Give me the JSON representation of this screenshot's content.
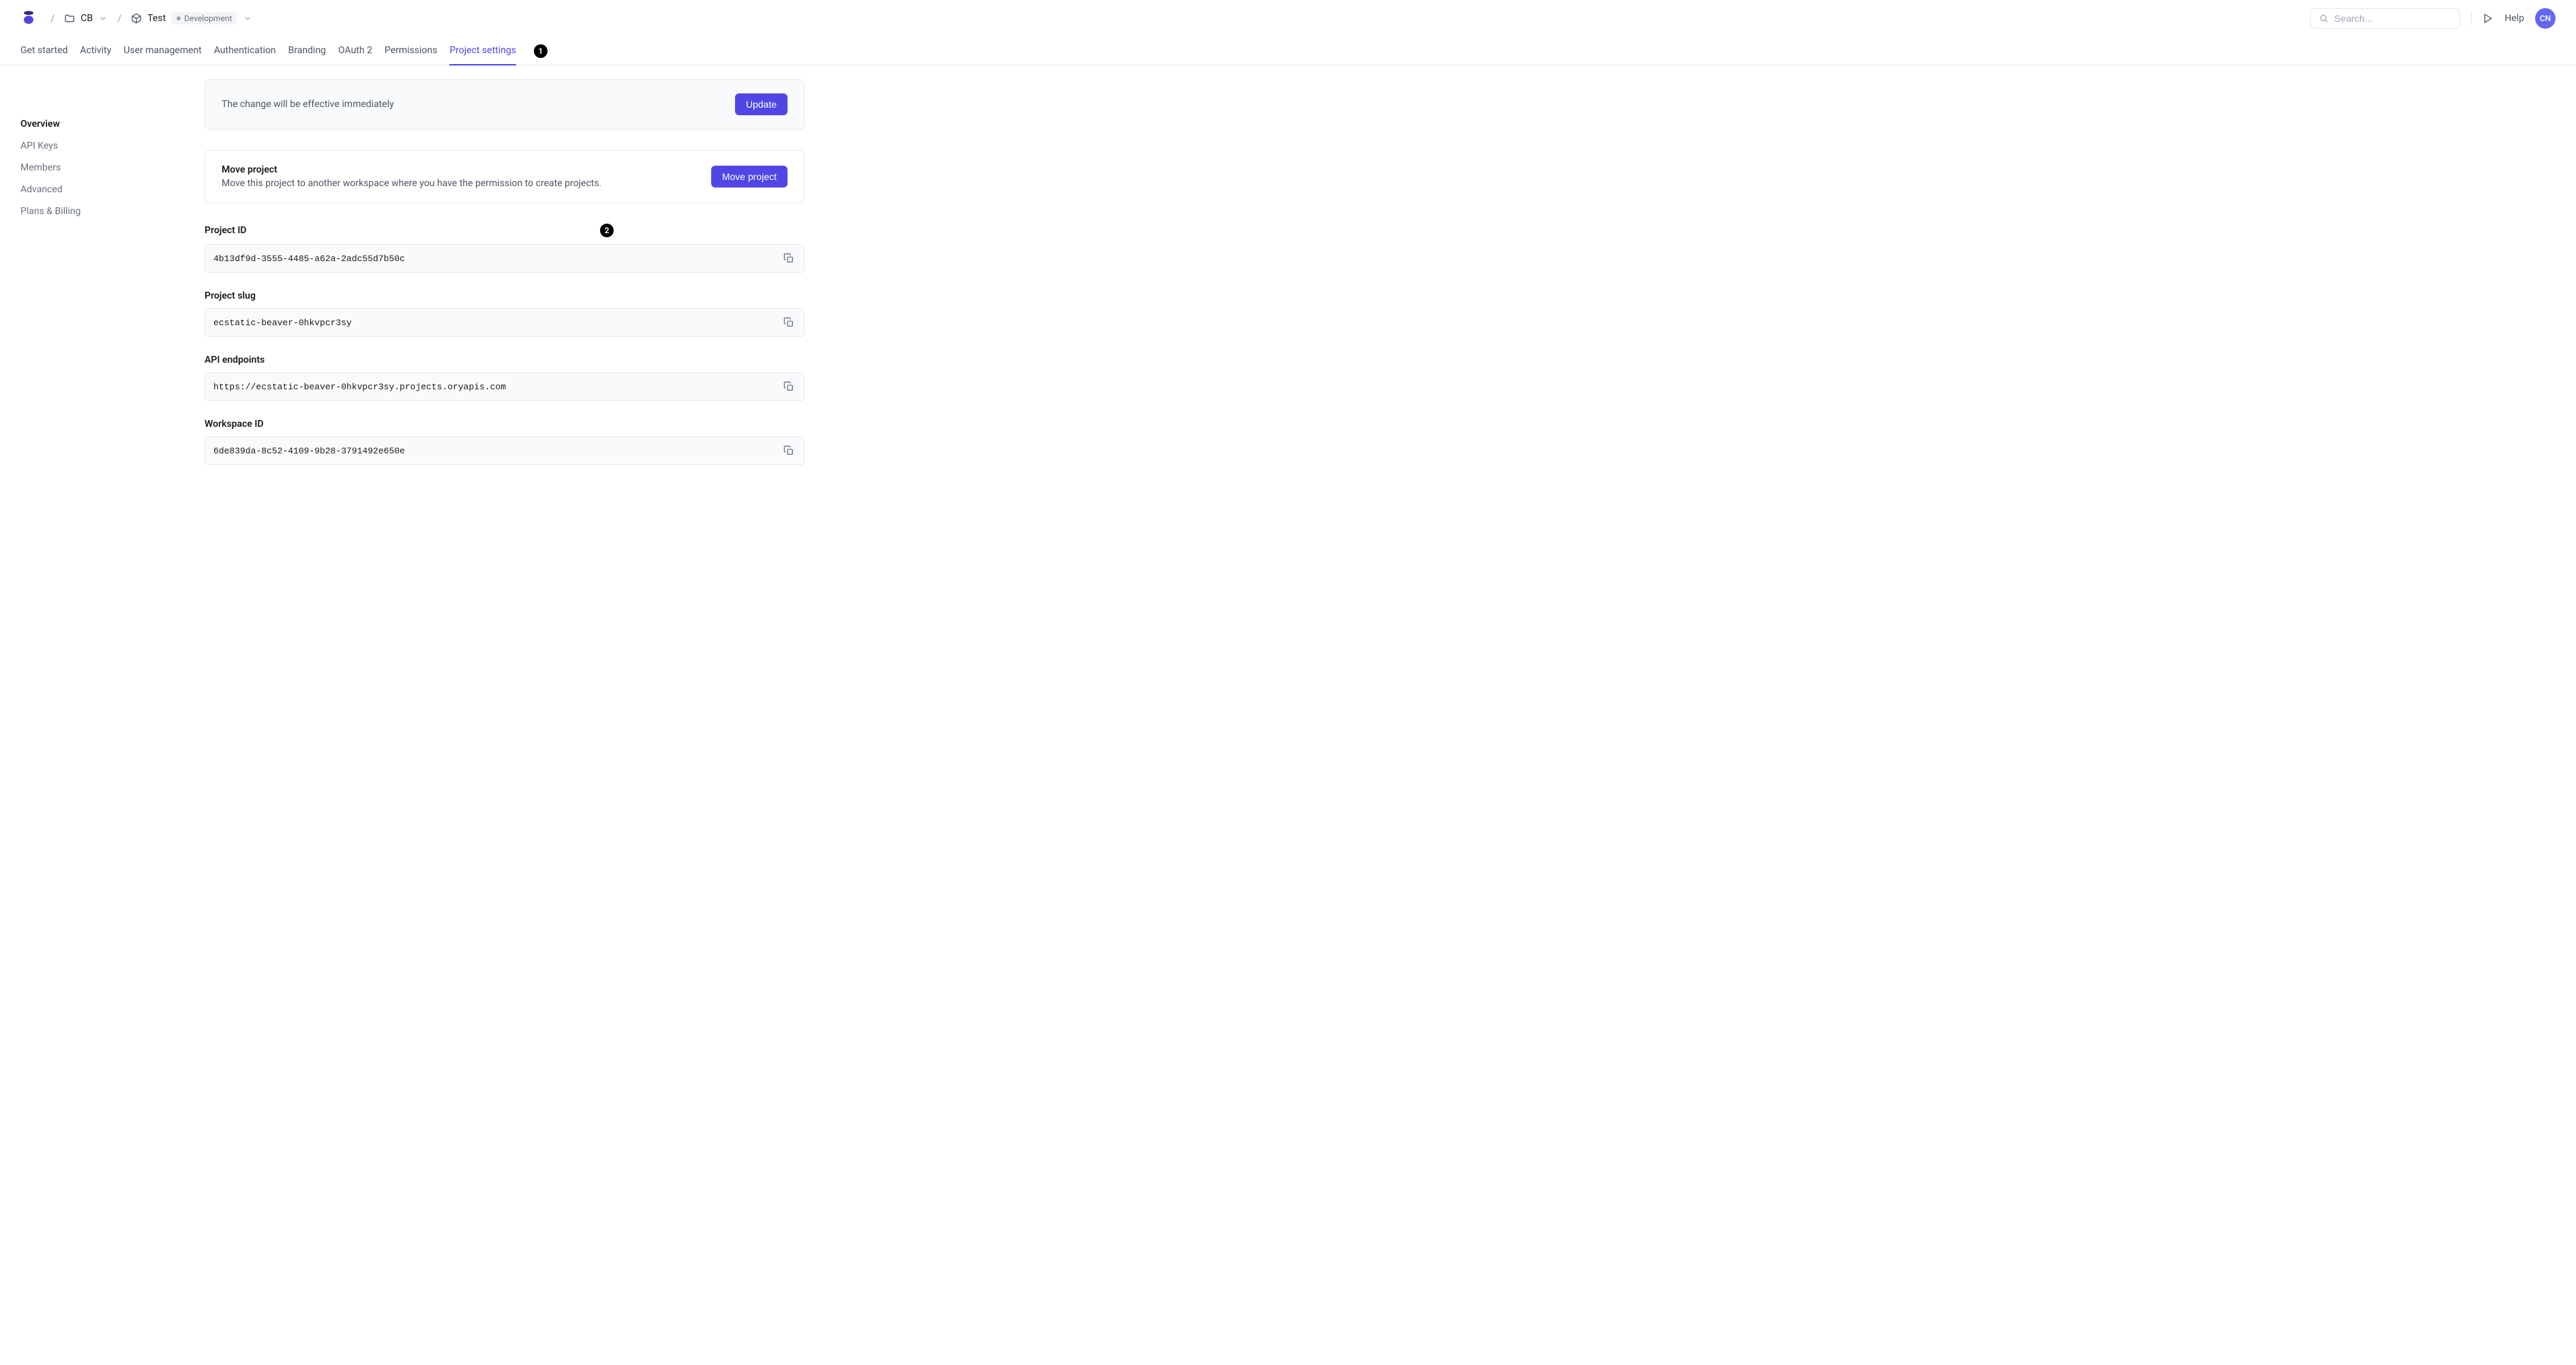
{
  "header": {
    "breadcrumb": {
      "workspace": "CB",
      "project": "Test",
      "env_label": "Development"
    },
    "search_placeholder": "Search...",
    "help_label": "Help",
    "avatar_initials": "CN"
  },
  "tabs": [
    {
      "label": "Get started",
      "active": false
    },
    {
      "label": "Activity",
      "active": false
    },
    {
      "label": "User management",
      "active": false
    },
    {
      "label": "Authentication",
      "active": false
    },
    {
      "label": "Branding",
      "active": false
    },
    {
      "label": "OAuth 2",
      "active": false
    },
    {
      "label": "Permissions",
      "active": false
    },
    {
      "label": "Project settings",
      "active": true
    }
  ],
  "annotations": {
    "tab_badge": "1",
    "project_id_badge": "2"
  },
  "sidebar": {
    "items": [
      {
        "label": "Overview",
        "active": true
      },
      {
        "label": "API Keys",
        "active": false
      },
      {
        "label": "Members",
        "active": false
      },
      {
        "label": "Advanced",
        "active": false
      },
      {
        "label": "Plans & Billing",
        "active": false
      }
    ]
  },
  "cards": {
    "update": {
      "notice": "The change will be effective immediately",
      "button": "Update"
    },
    "move": {
      "title": "Move project",
      "desc": "Move this project to another workspace where you have the permission to create projects.",
      "button": "Move project"
    }
  },
  "fields": {
    "project_id": {
      "label": "Project ID",
      "value": "4b13df9d-3555-4485-a62a-2adc55d7b50c"
    },
    "project_slug": {
      "label": "Project slug",
      "value": "ecstatic-beaver-0hkvpcr3sy"
    },
    "api_endpoints": {
      "label": "API endpoints",
      "value": "https://ecstatic-beaver-0hkvpcr3sy.projects.oryapis.com"
    },
    "workspace_id": {
      "label": "Workspace ID",
      "value": "6de839da-8c52-4109-9b28-3791492e650e"
    }
  }
}
